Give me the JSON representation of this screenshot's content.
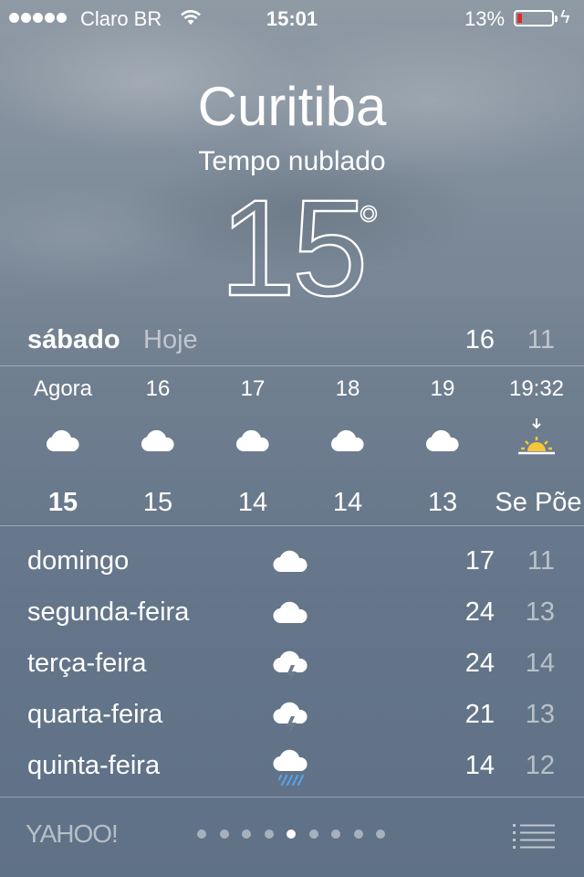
{
  "status_bar": {
    "carrier": "Claro BR",
    "time": "15:01",
    "battery_percent": "13%",
    "battery_level": 0.13,
    "battery_color": "#e12a2a",
    "icons": [
      "signal-dots-icon",
      "wifi-icon",
      "battery-icon",
      "charging-bolt-icon"
    ]
  },
  "location": {
    "city": "Curitiba",
    "condition": "Tempo nublado",
    "temperature": "15",
    "degree": "°"
  },
  "today": {
    "day": "sábado",
    "label": "Hoje",
    "high": "16",
    "low": "11"
  },
  "hourly": [
    {
      "time": "Agora",
      "icon": "cloud-icon",
      "value": "15",
      "bold": true
    },
    {
      "time": "16",
      "icon": "cloud-icon",
      "value": "15"
    },
    {
      "time": "17",
      "icon": "cloud-icon",
      "value": "14"
    },
    {
      "time": "18",
      "icon": "cloud-icon",
      "value": "14"
    },
    {
      "time": "19",
      "icon": "cloud-icon",
      "value": "13"
    },
    {
      "time": "19:32",
      "icon": "sunset-icon",
      "value": "Se Põe"
    }
  ],
  "daily": [
    {
      "day": "domingo",
      "icon": "cloud-icon",
      "high": "17",
      "low": "11"
    },
    {
      "day": "segunda-feira",
      "icon": "cloud-icon",
      "high": "24",
      "low": "13"
    },
    {
      "day": "terça-feira",
      "icon": "thunderstorm-icon",
      "high": "24",
      "low": "14"
    },
    {
      "day": "quarta-feira",
      "icon": "thunderstorm-icon",
      "high": "21",
      "low": "13"
    },
    {
      "day": "quinta-feira",
      "icon": "rain-icon",
      "high": "14",
      "low": "12"
    }
  ],
  "footer": {
    "provider": "YAHOO!",
    "page_count": 9,
    "active_page": 5,
    "list_icon": "list-icon"
  }
}
